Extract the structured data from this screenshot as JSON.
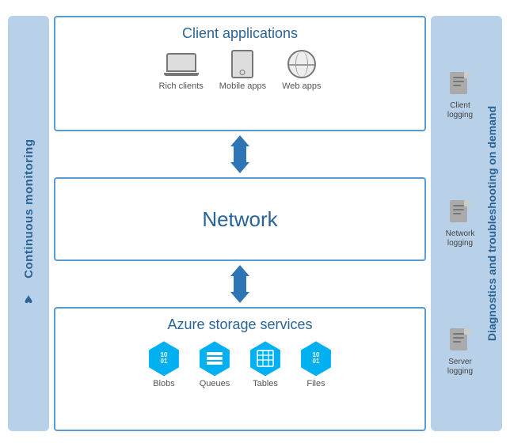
{
  "leftSidebar": {
    "label": "Continuous monitoring"
  },
  "clientApps": {
    "title": "Client applications",
    "icons": [
      {
        "label": "Rich clients",
        "type": "laptop"
      },
      {
        "label": "Mobile apps",
        "type": "tablet"
      },
      {
        "label": "Web apps",
        "type": "globe"
      }
    ]
  },
  "network": {
    "title": "Network"
  },
  "azureStorage": {
    "title": "Azure storage services",
    "icons": [
      {
        "label": "Blobs",
        "type": "blob"
      },
      {
        "label": "Queues",
        "type": "queue"
      },
      {
        "label": "Tables",
        "type": "table"
      },
      {
        "label": "Files",
        "type": "files"
      }
    ]
  },
  "rightSidebar": {
    "title": "Diagnostics and troubleshooting on demand",
    "loggingItems": [
      {
        "label": "Client\nlogging"
      },
      {
        "label": "Network\nlogging"
      },
      {
        "label": "Server\nlogging"
      }
    ]
  }
}
